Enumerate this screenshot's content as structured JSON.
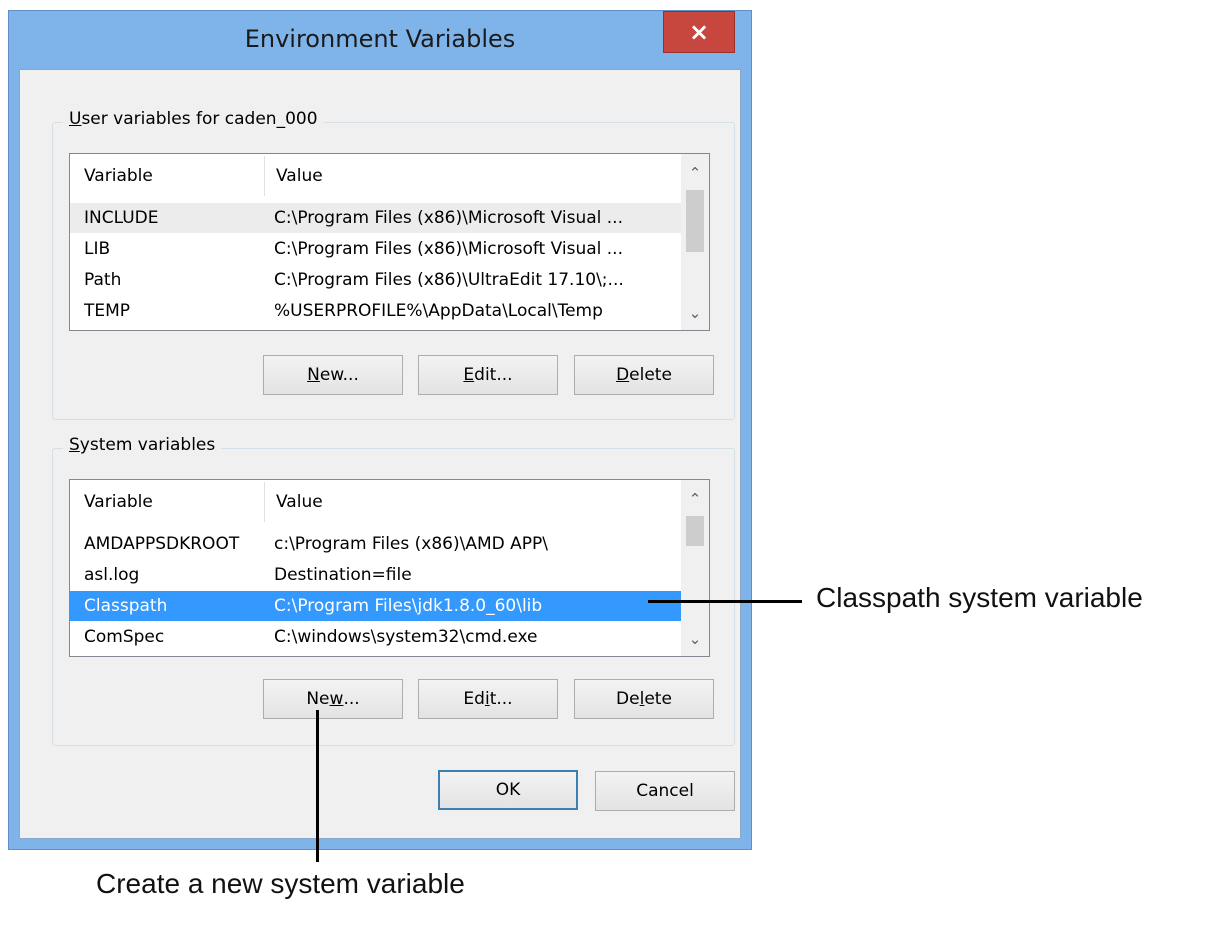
{
  "window": {
    "title": "Environment Variables",
    "close_glyph": "×"
  },
  "user_group": {
    "label_access": "U",
    "label_rest": "ser variables for caden_000",
    "columns": [
      "Variable",
      "Value"
    ],
    "rows": [
      {
        "variable": "INCLUDE",
        "value": "C:\\Program Files (x86)\\Microsoft Visual ..."
      },
      {
        "variable": "LIB",
        "value": "C:\\Program Files (x86)\\Microsoft Visual ..."
      },
      {
        "variable": "Path",
        "value": "C:\\Program Files (x86)\\UltraEdit 17.10\\;..."
      },
      {
        "variable": "TEMP",
        "value": "%USERPROFILE%\\AppData\\Local\\Temp"
      }
    ],
    "buttons": {
      "new_access": "N",
      "new_rest": "ew...",
      "edit_access": "E",
      "edit_rest": "dit...",
      "delete_access": "D",
      "delete_rest": "elete"
    }
  },
  "system_group": {
    "label_access": "S",
    "label_rest": "ystem variables",
    "columns": [
      "Variable",
      "Value"
    ],
    "rows": [
      {
        "variable": "AMDAPPSDKROOT",
        "value": "c:\\Program Files (x86)\\AMD APP\\"
      },
      {
        "variable": "asl.log",
        "value": "Destination=file"
      },
      {
        "variable": "Classpath",
        "value": "C:\\Program Files\\jdk1.8.0_60\\lib"
      },
      {
        "variable": "ComSpec",
        "value": "C:\\windows\\system32\\cmd.exe"
      }
    ],
    "selected_row": "Classpath",
    "buttons": {
      "new_pre": "Ne",
      "new_access": "w",
      "new_rest": "...",
      "edit_pre": "Ed",
      "edit_access": "i",
      "edit_rest": "t...",
      "delete_pre": "De",
      "delete_access": "l",
      "delete_rest": "ete"
    }
  },
  "dialog_buttons": {
    "ok": "OK",
    "cancel": "Cancel"
  },
  "callouts": {
    "classpath": "Classpath system variable",
    "new_system": "Create a new system variable"
  },
  "colors": {
    "title_bar": "#7eb4ea",
    "close_button": "#c7463d",
    "selection": "#3399ff"
  },
  "icons": {
    "scroll_up": "chevron-up-icon",
    "scroll_down": "chevron-down-icon",
    "close": "close-icon"
  }
}
